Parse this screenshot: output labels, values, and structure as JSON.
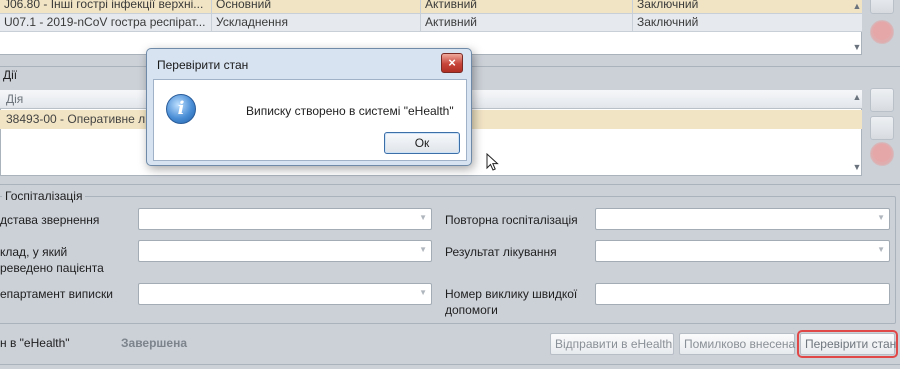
{
  "diagnoses": {
    "rows": [
      {
        "code": "J06.80 - Інші гострі інфекції верхні...",
        "type": "Основний",
        "status": "Активний",
        "kind": "Заключний"
      },
      {
        "code": "U07.1 - 2019-nCoV гостра респірат...",
        "type": "Ускладнення",
        "status": "Активний",
        "kind": "Заключний"
      }
    ]
  },
  "actions": {
    "group_title": "Дії",
    "column_header": "Дія",
    "rows": [
      {
        "label": "38493-00 - Оперативне л"
      }
    ]
  },
  "hospitalization": {
    "group_title": "Госпіталізація",
    "fields": {
      "reason": {
        "label": "дстава звернення"
      },
      "department_transfer": {
        "label_line1": "клад, у який",
        "label_line2": "реведено пацієнта"
      },
      "discharge_department": {
        "label": "епартамент виписки"
      },
      "repeat_hospitalization": {
        "label": "Повторна госпіталізація"
      },
      "treatment_result": {
        "label": "Результат лікування"
      },
      "ambulance_call": {
        "label_line1": "Номер виклику швидкої",
        "label_line2": "допомоги",
        "value": ""
      }
    }
  },
  "footer": {
    "status_label": "н в \"eHealth\"",
    "status_value": "Завершена",
    "buttons": {
      "send": "Відправити в eHealth",
      "mistaken": "Помилково внесена",
      "check_status": "Перевірити стан"
    }
  },
  "dialog": {
    "title": "Перевірити стан",
    "message": "Виписку створено в системі \"eHealth\"",
    "ok": "Ок",
    "close_glyph": "×",
    "icon_glyph": "i"
  },
  "colors": {
    "highlight_border": "#e04848",
    "selected_row": "#f1e4c4",
    "background": "#ccd1d8"
  }
}
